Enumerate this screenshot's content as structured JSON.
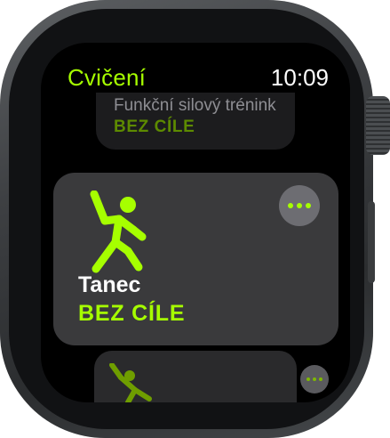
{
  "header": {
    "title": "Cvičení",
    "time": "10:09"
  },
  "workouts": {
    "previous": {
      "name": "Funkční silový trénink",
      "goal": "BEZ CÍLE"
    },
    "current": {
      "name": "Tanec",
      "goal": "BEZ CÍLE"
    }
  },
  "icons": {
    "current_workout_icon": "dance-figure-icon",
    "next_workout_icon": "stretch-figure-icon",
    "more_icon": "ellipsis-icon"
  },
  "colors": {
    "accent": "#a6ff00",
    "card": "#3a3a3c",
    "screen": "#000000"
  }
}
